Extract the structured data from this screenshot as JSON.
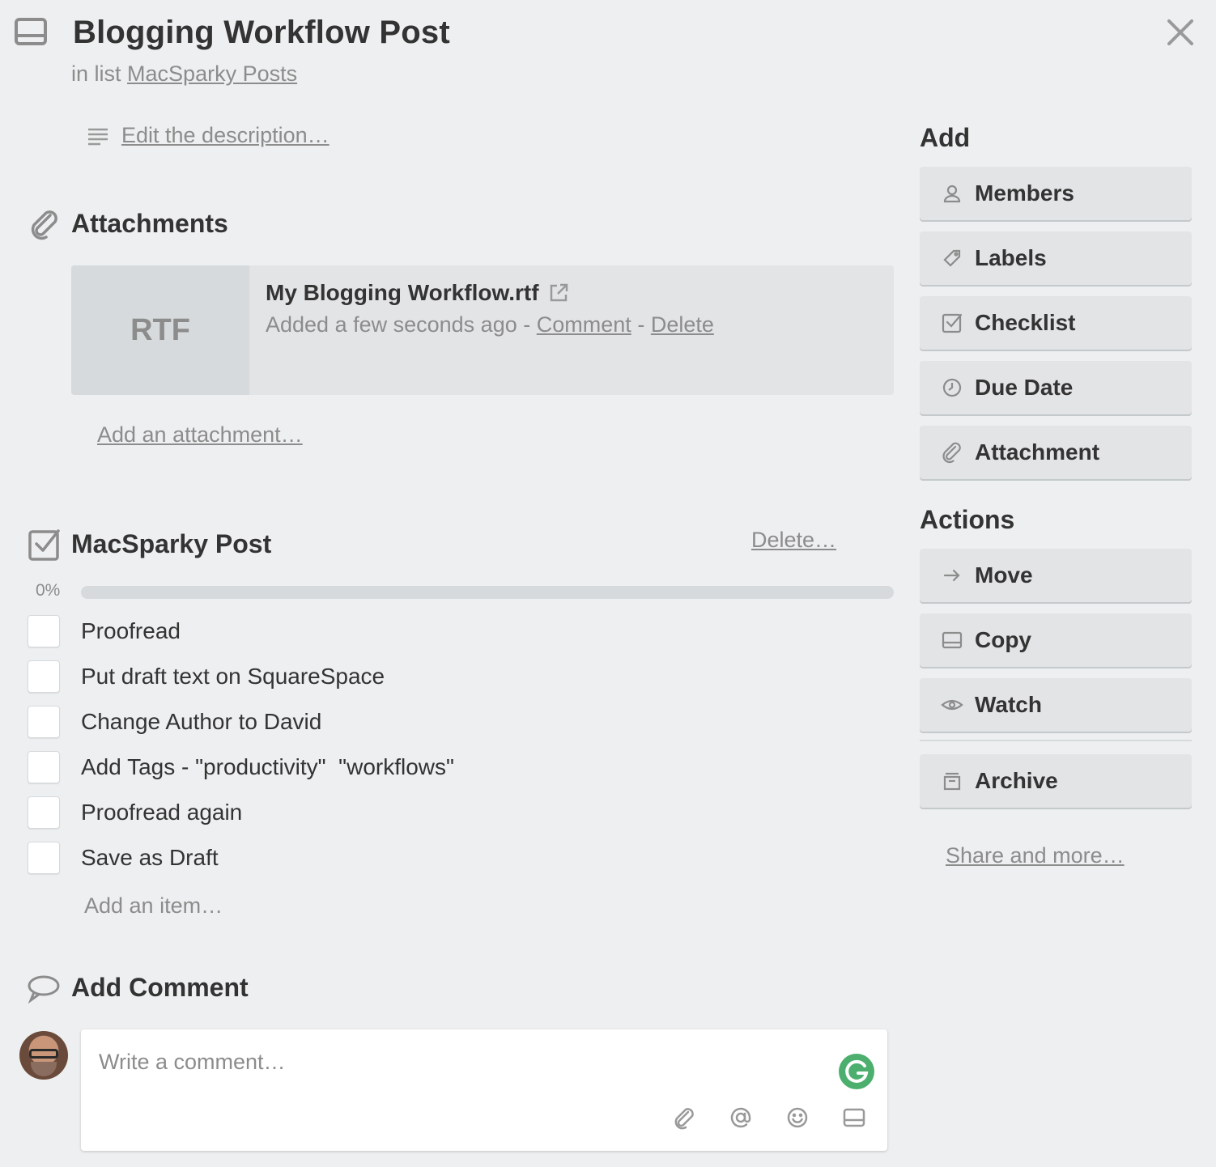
{
  "card": {
    "title": "Blogging Workflow Post",
    "in_list_prefix": "in list",
    "list_name": "MacSparky Posts"
  },
  "description": {
    "edit_link": "Edit the description…"
  },
  "attachments": {
    "heading": "Attachments",
    "items": [
      {
        "thumb_label": "RTF",
        "name": "My Blogging Workflow.rtf",
        "added": "Added a few seconds ago",
        "separator": "-",
        "comment_link": "Comment",
        "delete_link": "Delete"
      }
    ],
    "add_link": "Add an attachment…"
  },
  "checklist": {
    "title": "MacSparky Post",
    "delete_link": "Delete…",
    "progress_label": "0%",
    "progress_fraction": 0,
    "items": [
      {
        "label": "Proofread",
        "checked": false
      },
      {
        "label": "Put draft text on SquareSpace",
        "checked": false
      },
      {
        "label": "Change Author to David",
        "checked": false
      },
      {
        "label": "Add Tags - \"productivity\"  \"workflows\"",
        "checked": false
      },
      {
        "label": "Proofread again",
        "checked": false
      },
      {
        "label": "Save as Draft",
        "checked": false
      }
    ],
    "add_item": "Add an item…"
  },
  "comment": {
    "heading": "Add Comment",
    "placeholder": "Write a comment…",
    "tools": [
      "paperclip-icon",
      "at-sign-icon",
      "emoji-icon",
      "card-icon"
    ]
  },
  "sidebar": {
    "add_title": "Add",
    "add_buttons": [
      {
        "label": "Members",
        "icon": "person-icon"
      },
      {
        "label": "Labels",
        "icon": "tag-icon"
      },
      {
        "label": "Checklist",
        "icon": "checklist-icon"
      },
      {
        "label": "Due Date",
        "icon": "clock-icon"
      },
      {
        "label": "Attachment",
        "icon": "paperclip-icon"
      }
    ],
    "actions_title": "Actions",
    "action_buttons": [
      {
        "label": "Move",
        "icon": "arrow-right-icon"
      },
      {
        "label": "Copy",
        "icon": "card-icon"
      },
      {
        "label": "Watch",
        "icon": "eye-icon"
      }
    ],
    "archive_button": {
      "label": "Archive",
      "icon": "archive-icon"
    },
    "share_link": "Share and more…"
  },
  "colors": {
    "background": "#edeff0",
    "button": "#e2e4e6",
    "text": "#333333",
    "muted": "#8c8c8c",
    "grammarly": "#4caf6e"
  }
}
